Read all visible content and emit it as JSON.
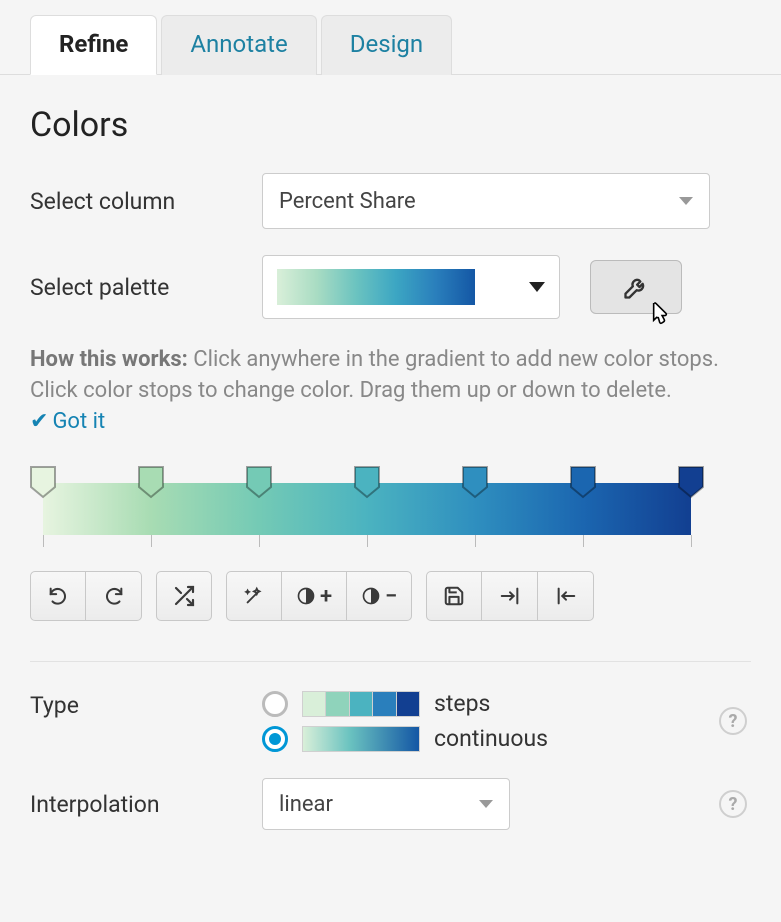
{
  "tabs": {
    "refine": "Refine",
    "annotate": "Annotate",
    "design": "Design",
    "active": "refine"
  },
  "section_title": "Colors",
  "labels": {
    "select_column": "Select column",
    "select_palette": "Select palette",
    "type": "Type",
    "interpolation": "Interpolation"
  },
  "column_select": {
    "value": "Percent Share"
  },
  "palette": {
    "stops": [
      {
        "pos": 0.0,
        "color": "#e7f4e0"
      },
      {
        "pos": 0.166,
        "color": "#a8dcb3"
      },
      {
        "pos": 0.333,
        "color": "#74cab5"
      },
      {
        "pos": 0.5,
        "color": "#4bb3c0"
      },
      {
        "pos": 0.666,
        "color": "#2f8fbf"
      },
      {
        "pos": 0.833,
        "color": "#1b66b0"
      },
      {
        "pos": 1.0,
        "color": "#123f91"
      }
    ]
  },
  "help_text": {
    "lead": "How this works:",
    "body": " Click anywhere in the gradient to add new color stops. Click color stops to change color. Drag them up or down to delete. ",
    "got_it": "Got it"
  },
  "toolbar": {
    "undo": "undo",
    "redo": "redo",
    "shuffle": "shuffle",
    "auto": "auto-correct",
    "light_plus": "+",
    "light_minus": "−",
    "save": "save",
    "import": "import",
    "export": "export"
  },
  "type_options": {
    "steps_label": "steps",
    "continuous_label": "continuous",
    "selected": "continuous",
    "steps_colors": [
      "#d9efd9",
      "#8fd3bb",
      "#4bb3c0",
      "#2a7fbc",
      "#123f91"
    ]
  },
  "interpolation": {
    "value": "linear"
  }
}
